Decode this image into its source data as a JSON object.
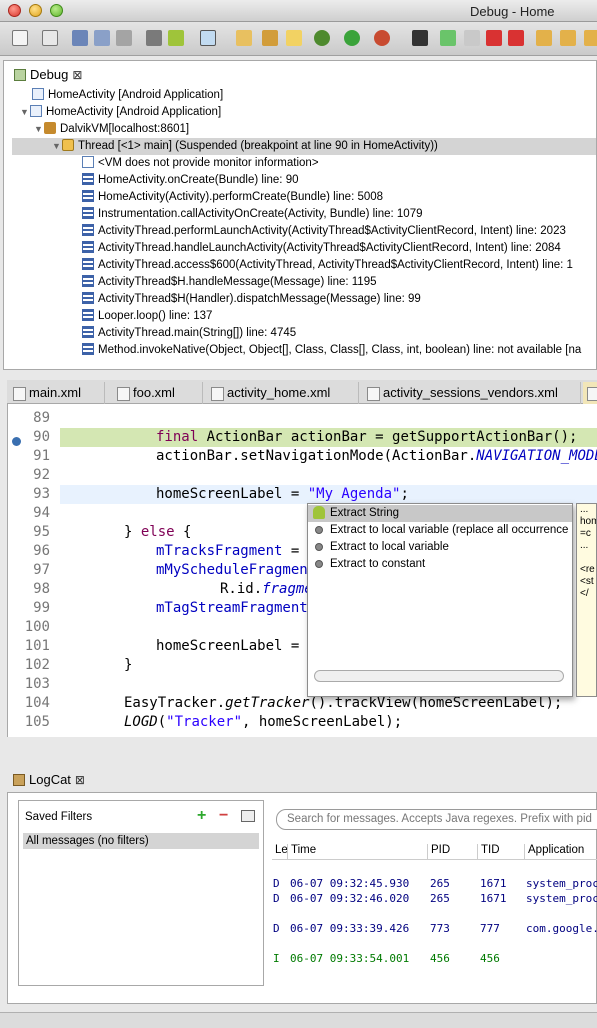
{
  "window": {
    "title": "Debug - Home"
  },
  "debug_view": {
    "tab_label": "Debug",
    "rows": [
      {
        "label": "HomeActivity [Android Application]"
      },
      {
        "label": "HomeActivity [Android Application]"
      },
      {
        "label": "DalvikVM[localhost:8601]"
      },
      {
        "label": "Thread [<1> main] (Suspended (breakpoint at line 90 in HomeActivity))"
      },
      {
        "label": "<VM does not provide monitor information>"
      },
      {
        "label": "HomeActivity.onCreate(Bundle) line: 90"
      },
      {
        "label": "HomeActivity(Activity).performCreate(Bundle) line: 5008"
      },
      {
        "label": "Instrumentation.callActivityOnCreate(Activity, Bundle) line: 1079"
      },
      {
        "label": "ActivityThread.performLaunchActivity(ActivityThread$ActivityClientRecord, Intent) line: 2023"
      },
      {
        "label": "ActivityThread.handleLaunchActivity(ActivityThread$ActivityClientRecord, Intent) line: 2084"
      },
      {
        "label": "ActivityThread.access$600(ActivityThread, ActivityThread$ActivityClientRecord, Intent) line: 1"
      },
      {
        "label": "ActivityThread$H.handleMessage(Message) line: 1195"
      },
      {
        "label": "ActivityThread$H(Handler).dispatchMessage(Message) line: 99"
      },
      {
        "label": "Looper.loop() line: 137"
      },
      {
        "label": "ActivityThread.main(String[]) line: 4745"
      },
      {
        "label": "Method.invokeNative(Object, Object[], Class, Class[], Class, int, boolean) line: not available [na"
      }
    ]
  },
  "editor": {
    "tabs": [
      {
        "label": "main.xml"
      },
      {
        "label": "foo.xml"
      },
      {
        "label": "activity_home.xml"
      },
      {
        "label": "activity_sessions_vendors.xml"
      }
    ],
    "lines": [
      {
        "num": "89"
      },
      {
        "num": "90",
        "p1": "final",
        "p2": " ActionBar actionBar = getSupportActionBar();"
      },
      {
        "num": "91",
        "p1": "actionBar.setNavigationMode(ActionBar.",
        "p2": "NAVIGATION_MODE_TA"
      },
      {
        "num": "92"
      },
      {
        "num": "93",
        "p1": "homeScreenLabel = ",
        "p2": "\"My Agenda\"",
        "p3": ";"
      },
      {
        "num": "94"
      },
      {
        "num": "95",
        "p1": "} ",
        "p2": "else",
        "p3": " {"
      },
      {
        "num": "96",
        "p1": "mTracksFragment",
        "p2": " = ("
      },
      {
        "num": "97",
        "p1": "mMyScheduleFragment"
      },
      {
        "num": "98",
        "p1": "R.id.",
        "p2": "fragme"
      },
      {
        "num": "99",
        "p1": "mTagStreamFragment"
      },
      {
        "num": "100"
      },
      {
        "num": "101",
        "p1": "homeScreenLabel = \""
      },
      {
        "num": "102",
        "p1": "}"
      },
      {
        "num": "103"
      },
      {
        "num": "104",
        "p1": "EasyTracker.",
        "p2": "getTracker",
        "p3": "().trackView(homeScreenLabel);"
      },
      {
        "num": "105",
        "p1": "LOGD",
        "p2": "(",
        "p3": "\"Tracker\"",
        "p4": ", homeScreenLabel);"
      }
    ],
    "quick_assist": [
      {
        "label": "Extract String"
      },
      {
        "label": "Extract to local variable (replace all occurrence"
      },
      {
        "label": "Extract to local variable"
      },
      {
        "label": "Extract to constant"
      }
    ],
    "detail_lines": [
      "...",
      "hom",
      "=c",
      "...",
      "",
      "<re",
      "<st",
      "</"
    ]
  },
  "logcat": {
    "tab_label": "LogCat",
    "saved_filters_label": "Saved Filters",
    "filters": [
      {
        "label": "All messages (no filters)"
      }
    ],
    "search_placeholder": "Search for messages. Accepts Java regexes. Prefix with pid",
    "columns": {
      "level": "Le",
      "time": "Time",
      "pid": "PID",
      "tid": "TID",
      "app": "Application"
    },
    "rows": [
      {
        "level": "D",
        "time": "06-07 09:32:45.930",
        "pid": "265",
        "tid": "1671",
        "app": "system_proc"
      },
      {
        "level": "D",
        "time": "06-07 09:32:46.020",
        "pid": "265",
        "tid": "1671",
        "app": "system_proc"
      },
      {
        "level": "D",
        "time": "06-07 09:33:39.426",
        "pid": "773",
        "tid": "777",
        "app": "com.google."
      },
      {
        "level": "I",
        "time": "06-07 09:33:54.001",
        "pid": "456",
        "tid": "456",
        "app": ""
      }
    ]
  },
  "colors": {
    "debug_level": "#000080",
    "info_level": "#007a00",
    "breakpoint_line": "#d4e7b3",
    "current_line": "#e8f2fe"
  }
}
